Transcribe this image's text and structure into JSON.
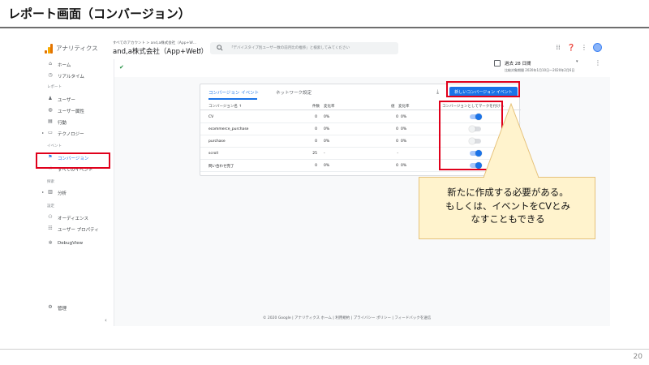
{
  "slide": {
    "title": "レポート画面（コンバージョン）",
    "page_number": "20"
  },
  "topbar": {
    "product_name": "アナリティクス",
    "account_crumb": "すべてのアカウント > and,a株式会社（App+W…",
    "account_name": "and,a株式会社（App+Web）",
    "search_placeholder": "「デバイスタイプ別ユーザー数の前月比の推移」と検索してみてください"
  },
  "date": {
    "label": "過去 28 日間",
    "range": "比較対象期間 2020年1月10日～2020年2月6日"
  },
  "sidebar": {
    "top_items": [
      {
        "label": "ホーム",
        "icon": "home-icon",
        "glyph": "⌂"
      },
      {
        "label": "リアルタイム",
        "icon": "clock-icon",
        "glyph": "◷"
      }
    ],
    "report_section": "レポート",
    "report_items": [
      {
        "label": "ユーザー",
        "icon": "person-icon",
        "glyph": "♟"
      },
      {
        "label": "ユーザー属性",
        "icon": "globe-icon",
        "glyph": "◍"
      },
      {
        "label": "行動",
        "icon": "table-icon",
        "glyph": "▤"
      },
      {
        "label": "テクノロジー",
        "icon": "devices-icon",
        "glyph": "▭"
      }
    ],
    "event_section": "イベント",
    "event_items": [
      {
        "label": "コンバージョン",
        "icon": "flag-icon",
        "glyph": "⚑"
      },
      {
        "label": "すべてのイベント",
        "icon": "touch-icon",
        "glyph": "☝"
      }
    ],
    "explore_section": "探索",
    "explore_items": [
      {
        "label": "分析",
        "icon": "analysis-icon",
        "glyph": "▥"
      }
    ],
    "config_section": "設定",
    "config_items": [
      {
        "label": "オーディエンス",
        "icon": "audience-icon",
        "glyph": "⚇"
      },
      {
        "label": "ユーザー プロパティ",
        "icon": "property-icon",
        "glyph": "☷"
      },
      {
        "label": "DebugView",
        "icon": "debug-icon",
        "glyph": "✲"
      }
    ],
    "admin_label": "管理",
    "collapse_glyph": "‹"
  },
  "card": {
    "tabs": [
      "コンバージョン イベント",
      "ネットワーク設定"
    ],
    "new_button": "新しいコンバージョン イベント",
    "headers": {
      "name": "コンバージョン名 ↑",
      "count": "件数",
      "count_change": "変化率",
      "value": "値",
      "value_change": "変化率",
      "toggle": "コンバージョンとしてマークを付ける"
    },
    "rows": [
      {
        "name": "CV",
        "count": "0",
        "count_change": "0%",
        "value": "0",
        "value_change": "0%",
        "marked": true
      },
      {
        "name": "ecommerce_purchase",
        "count": "0",
        "count_change": "0%",
        "value": "0",
        "value_change": "0%",
        "marked": false
      },
      {
        "name": "purchase",
        "count": "0",
        "count_change": "0%",
        "value": "0",
        "value_change": "0%",
        "marked": false
      },
      {
        "name": "scroll",
        "count": "25",
        "count_change": "-",
        "value": "-",
        "value_change": "",
        "marked": true
      },
      {
        "name": "問い合わせ完了",
        "count": "0",
        "count_change": "0%",
        "value": "0",
        "value_change": "0%",
        "marked": true
      }
    ]
  },
  "footer": "© 2020 Google | アナリティクス ホーム | 利用規約 | プライバシー ポリシー | フィードバックを送信",
  "callout": {
    "text": "新たに作成する必要がある。\nもしくは、イベントをCVとみ\nなすこともできる"
  },
  "colors": {
    "accent": "#1a73e8",
    "highlight": "#e0001b",
    "callout_bg": "#fff3cd"
  }
}
